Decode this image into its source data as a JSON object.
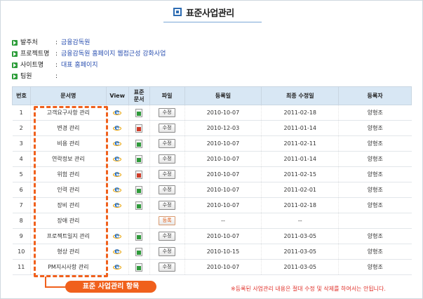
{
  "page": {
    "title": "표준사업관리",
    "colors": {
      "accent_blue": "#2e6db3",
      "header_bg": "#d8e7f4",
      "highlight_orange": "#f0601c",
      "bullet_green": "#2d9d3a",
      "note_red": "#e0322b"
    }
  },
  "info": [
    {
      "label": "발주처",
      "value": "금융감독원"
    },
    {
      "label": "프로젝트명",
      "value": "금융감독원 홈페이지 웹접근성 강화사업"
    },
    {
      "label": "사이트명",
      "value": "대표 홈페이지"
    },
    {
      "label": "팀원",
      "value": ""
    }
  ],
  "table": {
    "headers": {
      "no": "번호",
      "doc": "문서명",
      "view": "View",
      "std": "표준\n문서",
      "file": "파일",
      "reg": "등록일",
      "mod": "최종 수정일",
      "user": "등록자"
    },
    "rows": [
      {
        "no": "1",
        "doc": "고객요구사항 관리",
        "view_icon": "ie-icon",
        "std_icon": "excel-icon",
        "file": "수정",
        "reg": "2010-10-07",
        "mod": "2011-02-18",
        "user": "양형조"
      },
      {
        "no": "2",
        "doc": "변경 관리",
        "view_icon": "ie-icon",
        "std_icon": "ppt-icon",
        "file": "수정",
        "reg": "2010-12-03",
        "mod": "2011-01-14",
        "user": "양형조"
      },
      {
        "no": "3",
        "doc": "비용 관리",
        "view_icon": "ie-icon",
        "std_icon": "excel-icon",
        "file": "수정",
        "reg": "2010-10-07",
        "mod": "2011-02-11",
        "user": "양형조"
      },
      {
        "no": "4",
        "doc": "연락정보 관리",
        "view_icon": "ie-icon",
        "std_icon": "excel-icon",
        "file": "수정",
        "reg": "2010-10-07",
        "mod": "2011-01-14",
        "user": "양형조"
      },
      {
        "no": "5",
        "doc": "위험 관리",
        "view_icon": "ie-icon",
        "std_icon": "ppt-icon",
        "file": "수정",
        "reg": "2010-10-07",
        "mod": "2011-02-15",
        "user": "양형조"
      },
      {
        "no": "6",
        "doc": "인력 관리",
        "view_icon": "ie-icon",
        "std_icon": "excel-icon",
        "file": "수정",
        "reg": "2010-10-07",
        "mod": "2011-02-01",
        "user": "양형조"
      },
      {
        "no": "7",
        "doc": "장비 관리",
        "view_icon": "ie-icon",
        "std_icon": "excel-icon",
        "file": "수정",
        "reg": "2010-10-07",
        "mod": "2011-02-18",
        "user": "양형조"
      },
      {
        "no": "8",
        "doc": "장애 관리",
        "view_icon": "",
        "std_icon": "",
        "file": "등록",
        "reg": "--",
        "mod": "--",
        "user": ""
      },
      {
        "no": "9",
        "doc": "프로젝트일지 관리",
        "view_icon": "ie-icon",
        "std_icon": "excel-icon",
        "file": "수정",
        "reg": "2010-10-07",
        "mod": "2011-03-05",
        "user": "양형조"
      },
      {
        "no": "10",
        "doc": "형상 관리",
        "view_icon": "ie-icon",
        "std_icon": "excel-icon",
        "file": "수정",
        "reg": "2010-10-15",
        "mod": "2011-03-05",
        "user": "양형조"
      },
      {
        "no": "11",
        "doc": "PM지시사항 관리",
        "view_icon": "ie-icon",
        "std_icon": "excel-icon",
        "file": "수정",
        "reg": "2010-10-07",
        "mod": "2011-03-05",
        "user": "양형조"
      }
    ]
  },
  "callout": {
    "label": "표준 사업관리 항목"
  },
  "note": "※등록된 사업관리 내용은 절대 수정 및 삭제를 하여서는 안됩니다."
}
